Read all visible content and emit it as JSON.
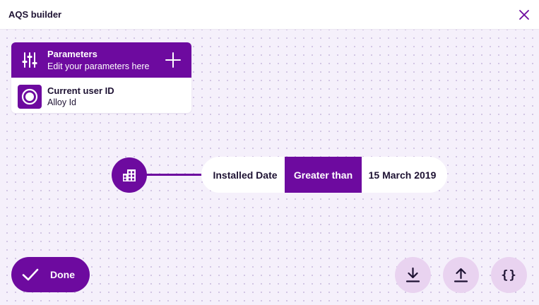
{
  "window": {
    "title": "AQS builder",
    "close_icon": "close-icon"
  },
  "colors": {
    "primary": "#6d0a9f",
    "secondary_button": "#e9d3f0",
    "canvas": "#f5f0fb",
    "text": "#1e1233"
  },
  "parameters": {
    "title": "Parameters",
    "subtitle": "Edit your parameters here",
    "header_icon": "sliders-icon",
    "add_icon": "plus-icon",
    "items": [
      {
        "name": "Current user ID",
        "type": "Alloy Id",
        "icon": "radio-target-icon"
      }
    ]
  },
  "query": {
    "entity_icon": "building-icon",
    "condition": {
      "field": "Installed Date",
      "operator": "Greater than",
      "value": "15 March 2019"
    }
  },
  "actions": {
    "done_label": "Done",
    "done_icon": "check-icon",
    "download_icon": "download-icon",
    "upload_icon": "upload-icon",
    "json_icon": "curly-braces-icon",
    "json_glyph": "{}"
  }
}
